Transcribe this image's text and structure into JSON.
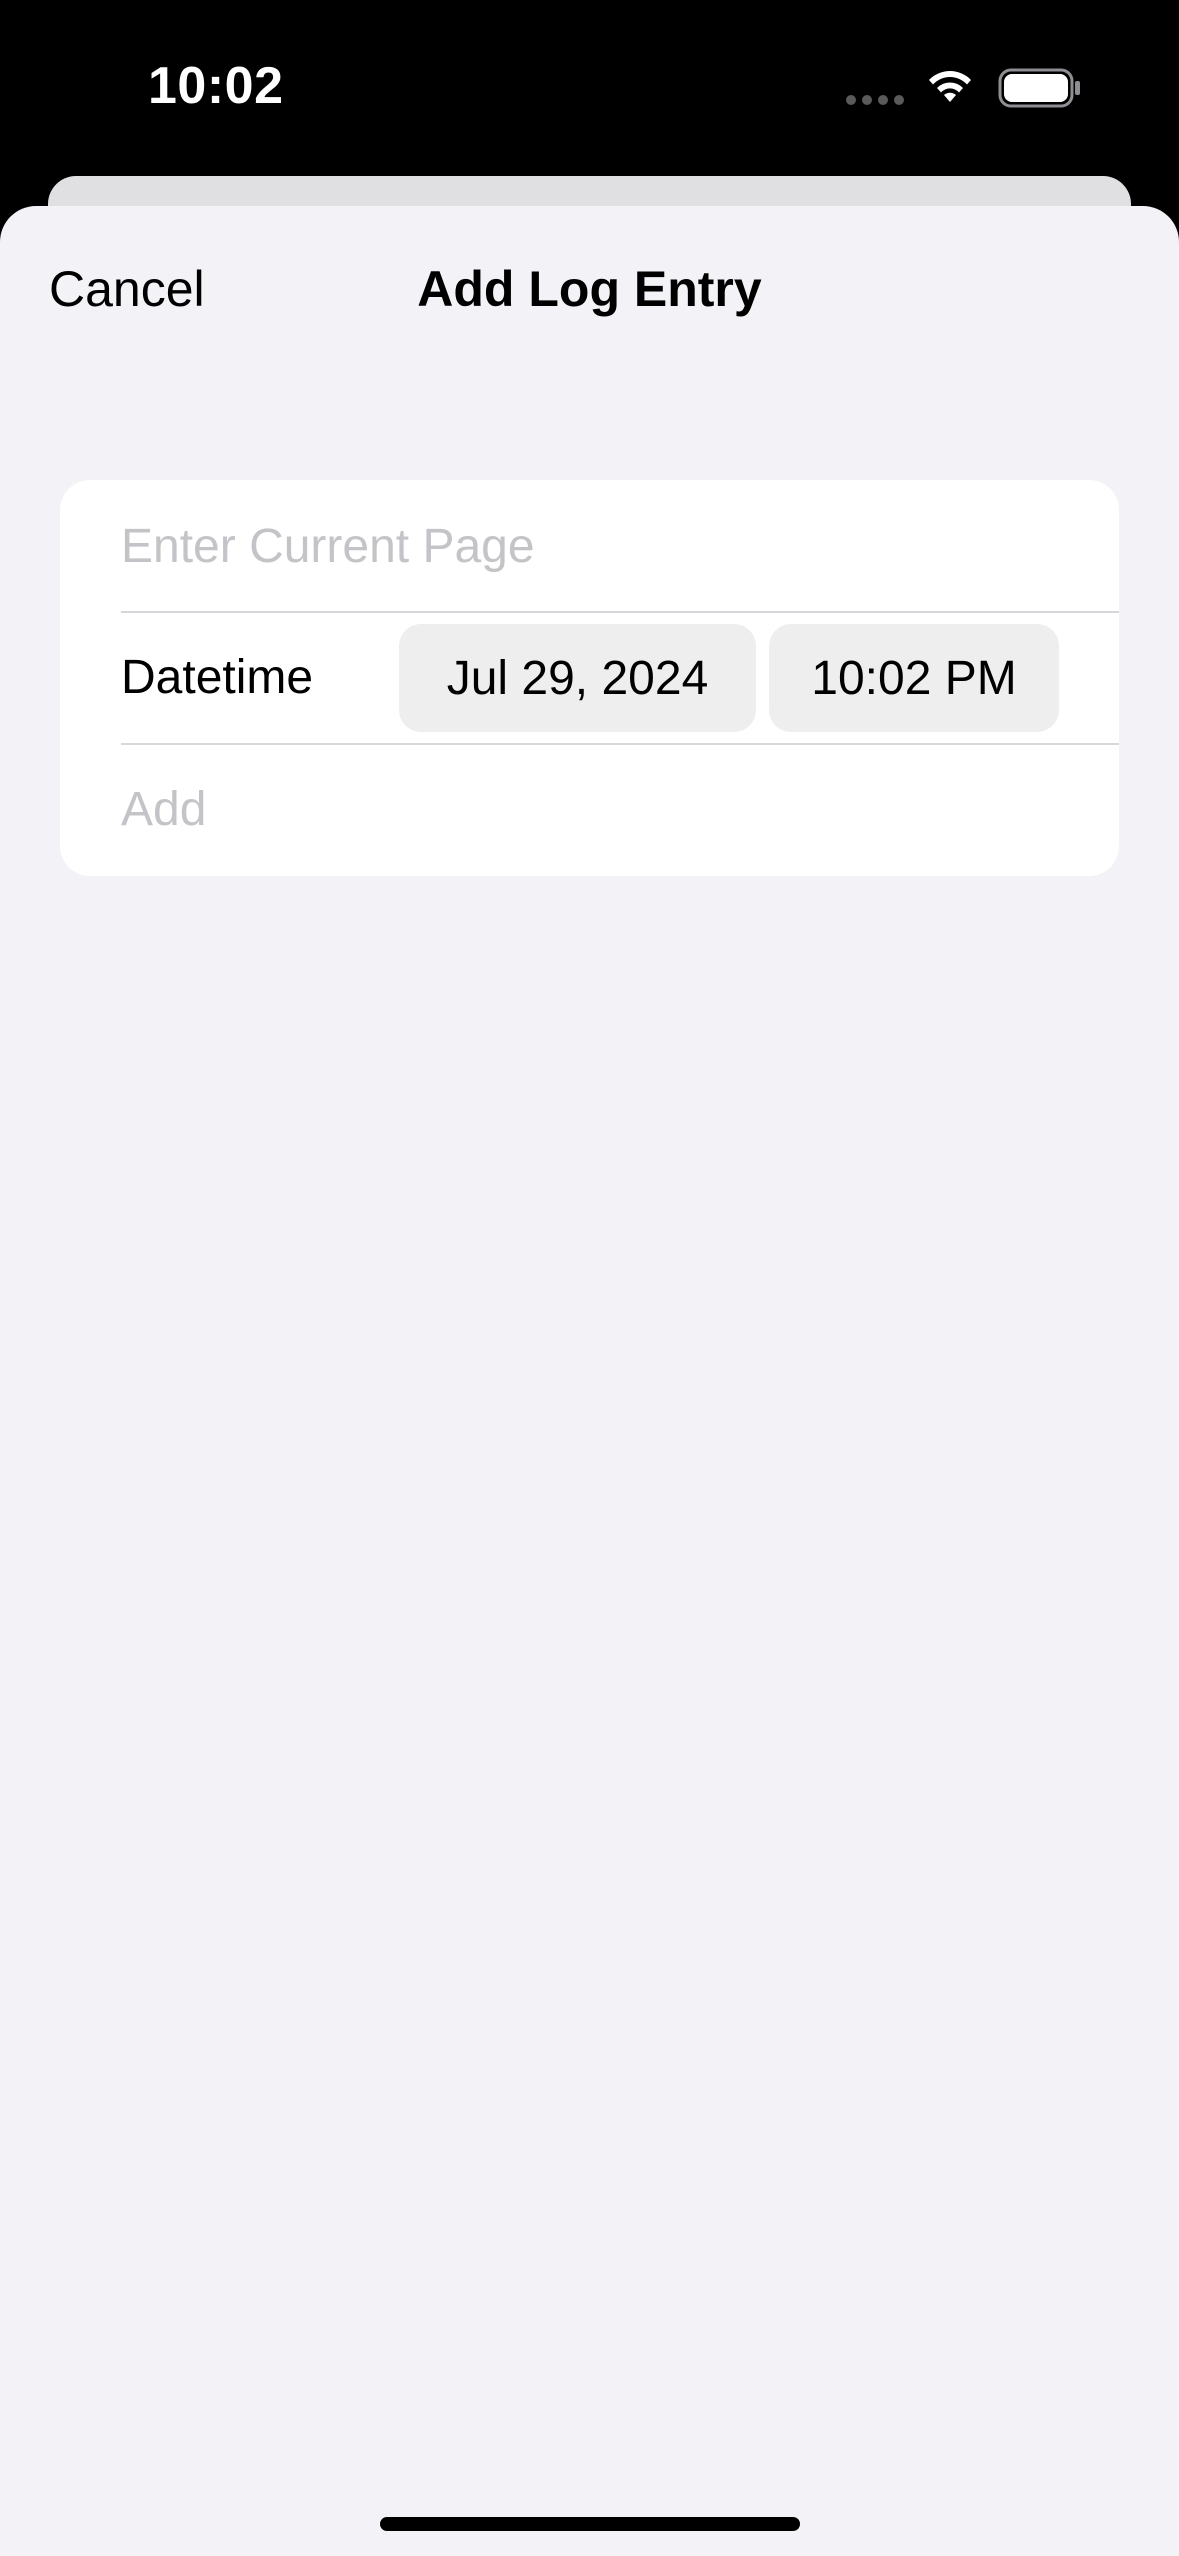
{
  "status_bar": {
    "time": "10:02",
    "icons": [
      "cellular-signal-icon",
      "wifi-icon",
      "battery-icon"
    ]
  },
  "navigation": {
    "cancel_label": "Cancel",
    "title": "Add Log Entry"
  },
  "form": {
    "page_field": {
      "value": "",
      "placeholder": "Enter Current Page"
    },
    "datetime": {
      "label": "Datetime",
      "date": "Jul 29, 2024",
      "time": "10:02 PM"
    },
    "add_label": "Add"
  },
  "colors": {
    "sheet_background": "#f2f2f7",
    "card_background": "#ffffff",
    "placeholder_text": "#c4c4c8",
    "pill_background": "#eeeeef",
    "separator": "#d8d8dc"
  }
}
